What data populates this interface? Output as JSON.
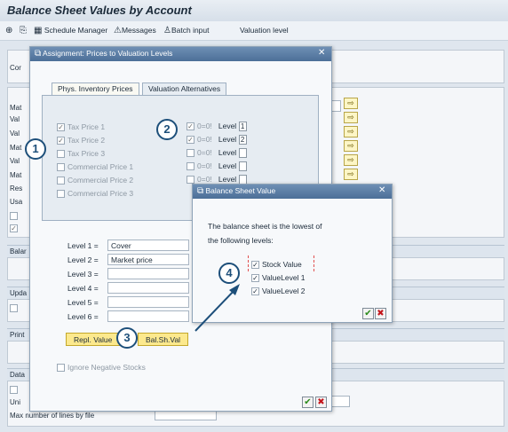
{
  "app_title": "Balance Sheet Values by Account",
  "toolbar": {
    "schedule_manager": "Schedule Manager",
    "messages": "Messages",
    "batch_input": "Batch input",
    "valuation_level": "Valuation level"
  },
  "background": {
    "labels": [
      "Cor",
      "Mat",
      "Val",
      "Val",
      "Mat",
      "Val",
      "Mat",
      "Res",
      "Usa"
    ],
    "section_bal": "Balar",
    "section_upd": "Upda",
    "section_print": "Print",
    "section_data": "Data",
    "uni_label": "Uni",
    "max_lines_label": "Max number of lines by file"
  },
  "assignment_dialog": {
    "title": "Assignment: Prices to Valuation Levels",
    "tabs": [
      "Phys. Inventory Prices",
      "Valuation Alternatives"
    ],
    "price_checks": [
      {
        "label": "Tax Price 1",
        "checked": true
      },
      {
        "label": "Tax Price 2",
        "checked": true
      },
      {
        "label": "Tax Price 3",
        "checked": false
      },
      {
        "label": "Commercial Price 1",
        "checked": false
      },
      {
        "label": "Commercial Price 2",
        "checked": false
      },
      {
        "label": "Commercial Price 3",
        "checked": false
      }
    ],
    "level_rows": [
      {
        "flag": "0=0!",
        "label": "Level",
        "value": "1",
        "checked": true
      },
      {
        "flag": "0=0!",
        "label": "Level",
        "value": "2",
        "checked": true
      },
      {
        "flag": "0=0!",
        "label": "Level",
        "value": "",
        "checked": false
      },
      {
        "flag": "0=0!",
        "label": "Level",
        "value": "",
        "checked": false
      },
      {
        "flag": "0=0!",
        "label": "Level",
        "value": "",
        "checked": false
      }
    ],
    "level_fields": [
      {
        "label": "Level 1 =",
        "value": "Cover"
      },
      {
        "label": "Level 2 =",
        "value": "Market price"
      },
      {
        "label": "Level 3 =",
        "value": ""
      },
      {
        "label": "Level 4 =",
        "value": ""
      },
      {
        "label": "Level 5 =",
        "value": ""
      },
      {
        "label": "Level 6 =",
        "value": ""
      }
    ],
    "repl_value_button": "Repl. Value",
    "bal_sh_val_button": "Bal.Sh.Val",
    "ignore_negative": "Ignore Negative Stocks"
  },
  "bsv_dialog": {
    "title": "Balance Sheet Value",
    "text_line1": "The balance sheet is the lowest of",
    "text_line2": "the following levels:",
    "options": [
      {
        "label": "Stock Value",
        "checked": true
      },
      {
        "label": "ValueLevel 1",
        "checked": true
      },
      {
        "label": "ValueLevel 2",
        "checked": true
      }
    ]
  },
  "badges": [
    "1",
    "2",
    "3",
    "4"
  ],
  "colors": {
    "accent": "#1d4f7a",
    "dialog_title": "#4c6f98",
    "button_yellow": "#fce98d"
  }
}
